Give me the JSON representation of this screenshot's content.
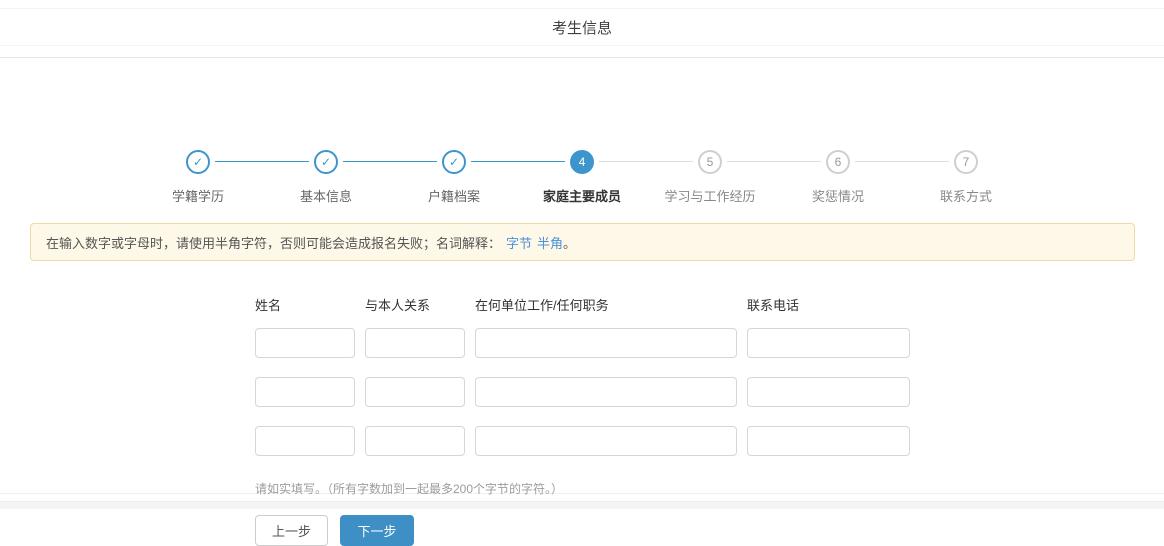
{
  "page": {
    "title": "考生信息"
  },
  "wizard": {
    "check_glyph": "✓",
    "steps": [
      {
        "num": "1",
        "label": "学籍学历",
        "state": "done"
      },
      {
        "num": "2",
        "label": "基本信息",
        "state": "done"
      },
      {
        "num": "3",
        "label": "户籍档案",
        "state": "done"
      },
      {
        "num": "4",
        "label": "家庭主要成员",
        "state": "active"
      },
      {
        "num": "5",
        "label": "学习与工作经历",
        "state": "todo"
      },
      {
        "num": "6",
        "label": "奖惩情况",
        "state": "todo"
      },
      {
        "num": "7",
        "label": "联系方式",
        "state": "todo"
      }
    ]
  },
  "notice": {
    "text": "在输入数字或字母时，请使用半角字符，否则可能会造成报名失败；名词解释：",
    "link1": "字节",
    "link2": "半角",
    "suffix": "。"
  },
  "form": {
    "columns": [
      {
        "label": "姓名",
        "value": ""
      },
      {
        "label": "与本人关系",
        "value": ""
      },
      {
        "label": "在何单位工作/任何职务",
        "value": ""
      },
      {
        "label": "联系电话",
        "value": ""
      }
    ],
    "row_count": 3,
    "note": "请如实填写。（所有字数加到一起最多200个字节的字符。）",
    "prev_label": "上一步",
    "next_label": "下一步"
  },
  "colors": {
    "accent_blue": "#3c96cd",
    "button_blue": "#3d8fc6",
    "link_blue": "#4a90d9",
    "notice_bg": "#fdf8e8",
    "notice_border": "#f0d9a8"
  }
}
